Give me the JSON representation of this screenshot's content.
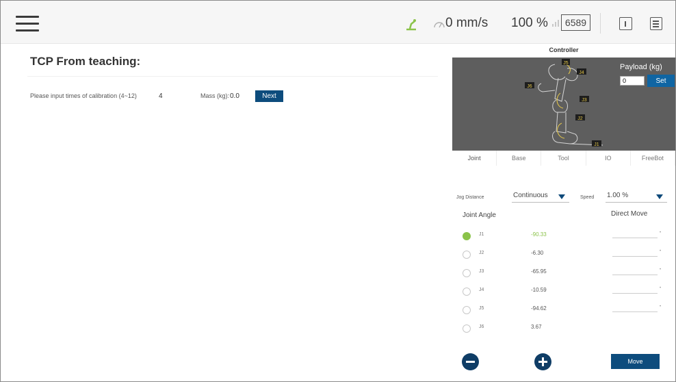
{
  "topbar": {
    "speed": "0 mm/s",
    "percent": "100 %",
    "counter": "6589"
  },
  "tcp": {
    "title": "TCP From teaching:",
    "calibration_label": "Please input times of calibration (4~12)",
    "calibration_value": "4",
    "mass_label": "Mass (kg):",
    "mass_value": "0.0",
    "next_label": "Next"
  },
  "controller": {
    "title": "Controller",
    "payload_label": "Payload (kg)",
    "payload_value": "0",
    "set_label": "Set",
    "joint_labels": [
      "J1",
      "J2",
      "J3",
      "J4",
      "J5",
      "J6"
    ],
    "tabs": [
      "Joint",
      "Base",
      "Tool",
      "IO",
      "FreeBot"
    ],
    "jog_distance_label": "Jog Distance",
    "jog_distance_value": "Continuous",
    "speed_label": "Speed",
    "speed_value": "1.00 %",
    "joint_angle_header": "Joint Angle",
    "direct_move_header": "Direct Move",
    "joints": [
      {
        "name": "J1",
        "value": "-90.33",
        "selected": true
      },
      {
        "name": "J2",
        "value": "-6.30",
        "selected": false
      },
      {
        "name": "J3",
        "value": "-65.95",
        "selected": false
      },
      {
        "name": "J4",
        "value": "-10.59",
        "selected": false
      },
      {
        "name": "J5",
        "value": "-94.62",
        "selected": false
      },
      {
        "name": "J6",
        "value": "3.67",
        "selected": false
      }
    ],
    "move_label": "Move"
  },
  "colors": {
    "accent": "#0d4c7d",
    "selected": "#8bc34a",
    "viewport": "#5e5e5e"
  }
}
